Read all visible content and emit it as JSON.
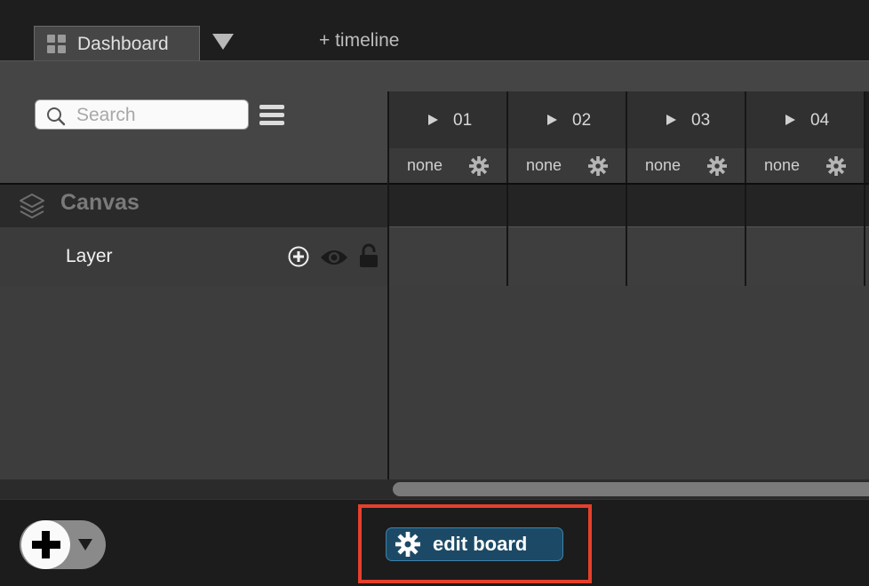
{
  "tabs": {
    "active": {
      "label": "Dashboard",
      "icon": "grid-icon"
    },
    "dropdown_icon": "triangle-down-icon",
    "add_timeline_label": "+ timeline"
  },
  "search": {
    "placeholder": "Search",
    "value": ""
  },
  "frames": [
    {
      "number": "01",
      "mode": "none"
    },
    {
      "number": "02",
      "mode": "none"
    },
    {
      "number": "03",
      "mode": "none"
    },
    {
      "number": "04",
      "mode": "none"
    }
  ],
  "layers": {
    "canvas_label": "Canvas",
    "layer_label": "Layer"
  },
  "bottom": {
    "edit_board_label": "edit board"
  },
  "colors": {
    "accent": "#1c4a66",
    "highlight": "#e5402c"
  }
}
